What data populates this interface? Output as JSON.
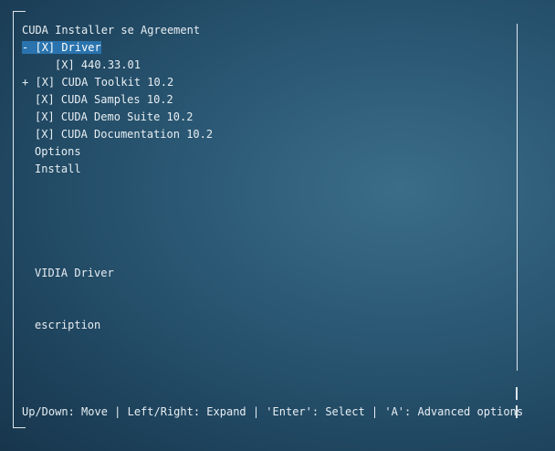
{
  "installer": {
    "title": "CUDA Installer se Agreement",
    "items": [
      {
        "expander": "-",
        "checkbox": "[X]",
        "label": "Driver",
        "selected": true
      },
      {
        "expander": "",
        "checkbox": "[X]",
        "label": "440.33.01",
        "indent": true
      },
      {
        "expander": "+",
        "checkbox": "[X]",
        "label": "CUDA Toolkit 10.2"
      },
      {
        "expander": "",
        "checkbox": "[X]",
        "label": "CUDA Samples 10.2"
      },
      {
        "expander": "",
        "checkbox": "[X]",
        "label": "CUDA Demo Suite 10.2"
      },
      {
        "expander": "",
        "checkbox": "[X]",
        "label": "CUDA Documentation 10.2"
      }
    ],
    "options_label": "Options",
    "install_label": "Install",
    "info_title": "VIDIA Driver",
    "info_description": "escription",
    "help_bar": "Up/Down: Move | Left/Right: Expand | 'Enter': Select | 'A': Advanced options"
  },
  "colors": {
    "selection": "#2a73ae",
    "text": "#e8eef2",
    "background": "#245068"
  }
}
